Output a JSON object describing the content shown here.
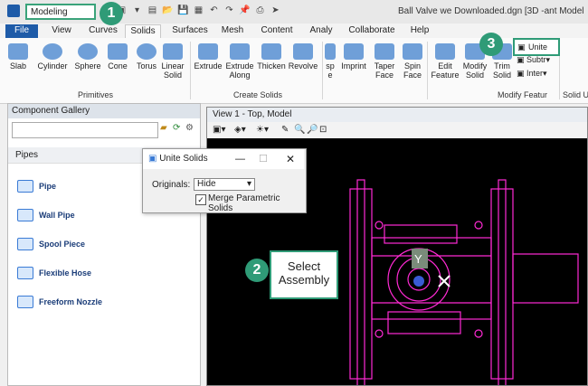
{
  "workflow": "Modeling",
  "window_title": "Ball Valve we Downloaded.dgn [3D -ant Model",
  "tabs": [
    "File",
    "View",
    "Curves",
    "Solids",
    "Surfaces",
    "Mesh",
    "Content",
    "Analy",
    "Collaborate",
    "Help"
  ],
  "ribbon": {
    "primitives": [
      "Slab",
      "Cylinder",
      "Sphere",
      "Cone",
      "Torus",
      "Linear\nSolid"
    ],
    "primitives_label": "Primitives",
    "create": [
      "Extrude",
      "Extrude\nAlong",
      "Thicken",
      "Revolve"
    ],
    "create_label": "Create Solids",
    "misc": [
      "sp\ne",
      "Imprint",
      "Taper\nFace",
      "Spin\nFace"
    ],
    "modify": [
      "Edit\nFeature",
      "Modify\nSolid",
      "Trim\nSolid"
    ],
    "modify_label": "Modify Featur",
    "solid_u_label": "Solid U",
    "unite": "Unite",
    "subtr": "Subtr",
    "inter": "Inter"
  },
  "gallery": {
    "title": "Component Gallery",
    "section": "Pipes",
    "items": [
      "Pipe",
      "Wall Pipe",
      "Spool Piece",
      "Flexible Hose",
      "Freeform Nozzle"
    ]
  },
  "view": {
    "title": "View 1 - Top, Model"
  },
  "dialog": {
    "title": "Unite Solids",
    "originals_label": "Originals:",
    "originals_value": "Hide",
    "merge_label": "Merge Parametric Solids"
  },
  "callouts": {
    "one": "1",
    "two": "2",
    "three": "3",
    "text": "Select\nAssembly"
  },
  "axis_label": "Y"
}
